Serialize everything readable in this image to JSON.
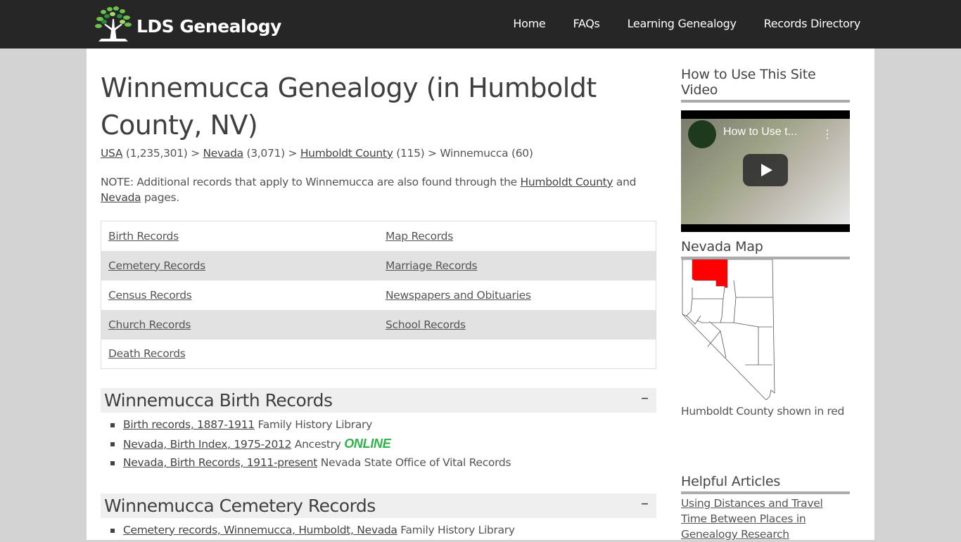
{
  "site": {
    "logo_text": "LDS Genealogy",
    "nav": [
      {
        "label": "Home"
      },
      {
        "label": "FAQs"
      },
      {
        "label": "Learning Genealogy"
      },
      {
        "label": "Records Directory"
      }
    ]
  },
  "page": {
    "title": "Winnemucca Genealogy (in Humboldt County, NV)",
    "breadcrumb": [
      {
        "label": "USA",
        "count": "(1,235,301)",
        "link": true
      },
      {
        "label": "Nevada",
        "count": "(3,071)",
        "link": true
      },
      {
        "label": "Humboldt County",
        "count": "(115)",
        "link": true
      },
      {
        "label": "Winnemucca",
        "count": "(60)",
        "link": false
      }
    ],
    "breadcrumb_sep": ">",
    "note": {
      "prefix": "NOTE: Additional records that apply to Winnemucca are also found through the ",
      "link1": "Humboldt County",
      "middle": " and ",
      "link2": "Nevada",
      "suffix": " pages."
    },
    "categories": [
      [
        "Birth Records",
        "Map Records"
      ],
      [
        "Cemetery Records",
        "Marriage Records"
      ],
      [
        "Census Records",
        "Newspapers and Obituaries"
      ],
      [
        "Church Records",
        "School Records"
      ],
      [
        "Death Records",
        ""
      ]
    ],
    "sections": [
      {
        "title": "Winnemucca Birth Records",
        "toggle": "–",
        "items": [
          {
            "link": "Birth records, 1887-1911",
            "source": "Family History Library",
            "badge": ""
          },
          {
            "link": "Nevada, Birth Index, 1975-2012",
            "source": "Ancestry",
            "badge": "ONLINE"
          },
          {
            "link": "Nevada, Birth Records, 1911-present",
            "source": "Nevada State Office of Vital Records",
            "badge": ""
          }
        ]
      },
      {
        "title": "Winnemucca Cemetery Records",
        "toggle": "–",
        "items": [
          {
            "link": "Cemetery records, Winnemucca, Humboldt, Nevada",
            "source": "Family History Library",
            "badge": ""
          }
        ]
      }
    ]
  },
  "sidebar": {
    "video_heading": "How to Use This Site Video",
    "video_title": "How to Use t...",
    "map_heading": "Nevada Map",
    "map_caption": "Humboldt County shown in red",
    "map_highlight_color": "#ff0000",
    "articles_heading": "Helpful Articles",
    "articles": [
      {
        "label": "Using Distances and Travel Time Between Places in Genealogy Research"
      }
    ]
  },
  "colors": {
    "topbar": "#262626",
    "background": "#d3d3d3",
    "online_badge": "#2db34a"
  }
}
